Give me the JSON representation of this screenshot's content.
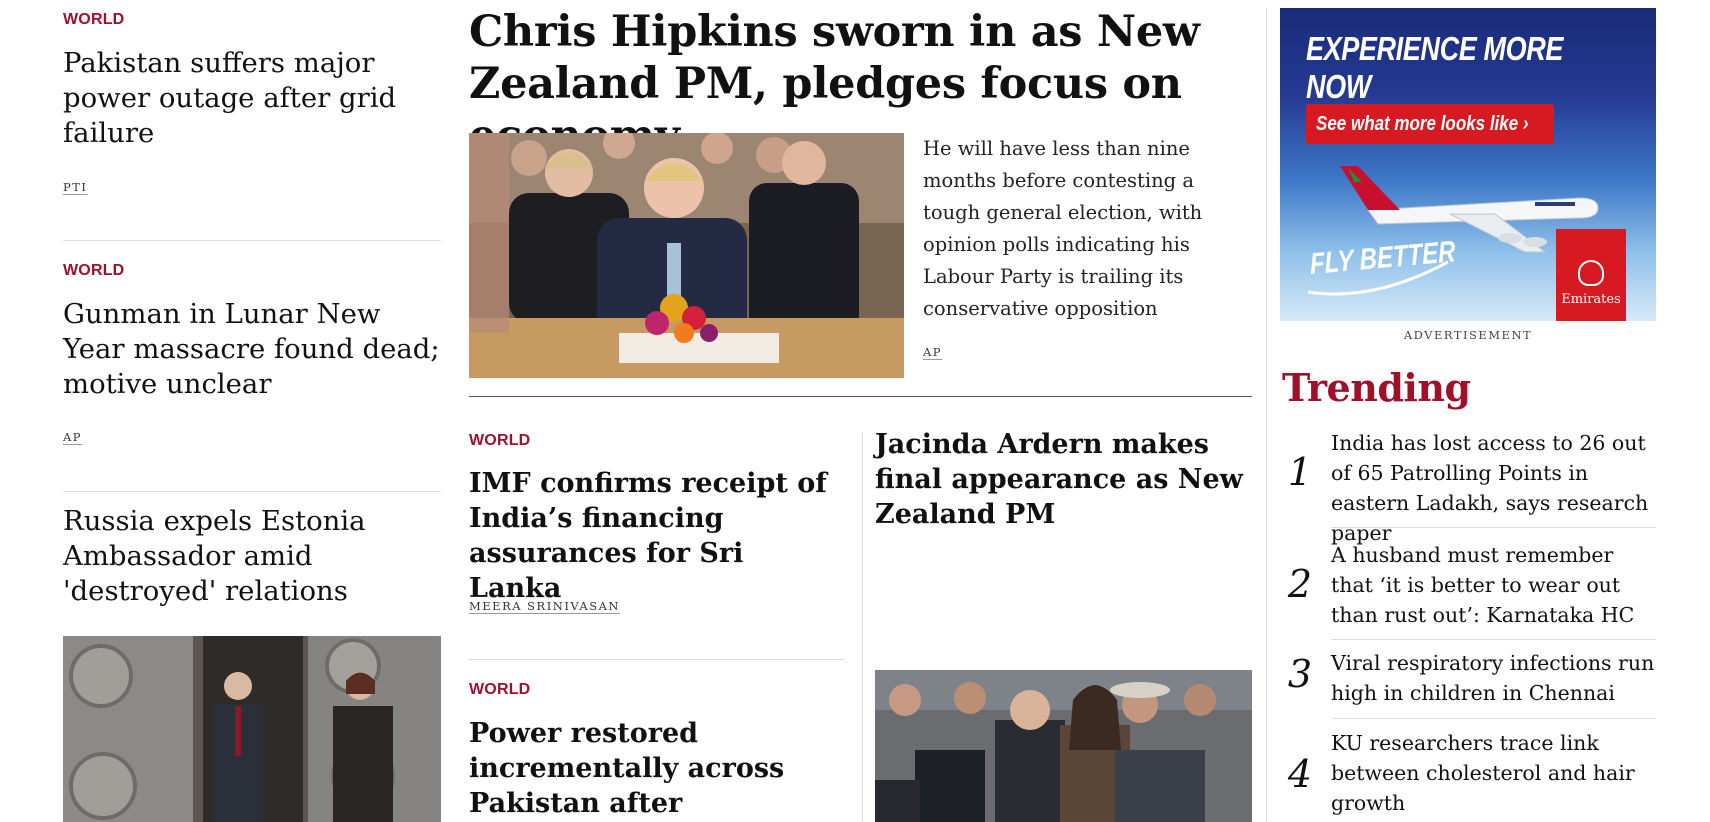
{
  "left_column": {
    "stories": [
      {
        "kicker": "WORLD",
        "headline": "Pakistan suffers major power outage after grid failure",
        "byline": "PTI"
      },
      {
        "kicker": "WORLD",
        "headline": "Gunman in Lunar New Year massacre found dead; motive unclear",
        "byline": "AP"
      },
      {
        "headline": "Russia expels Estonia Ambassador amid 'destroyed' relations"
      }
    ]
  },
  "lead_story": {
    "headline": "Chris Hipkins sworn in as New Zealand PM, pledges focus on economy",
    "summary": "He will have less than nine months before contesting a tough general election, with opinion polls indicating his Labour Party is trailing its conservative opposition",
    "byline": "AP"
  },
  "middle_stories": [
    {
      "kicker": "WORLD",
      "headline": "IMF confirms receipt of India’s financing assurances for Sri Lanka",
      "byline": "MEERA SRINIVASAN"
    },
    {
      "headline": "Jacinda Ardern makes final appearance as New Zealand PM"
    },
    {
      "kicker": "WORLD",
      "headline": "Power restored incrementally across Pakistan after nationwide"
    }
  ],
  "advertisement": {
    "tagline": "EXPERIENCE MORE NOW",
    "cta": "See what more looks like ›",
    "slogan": "FLY BETTER",
    "brand": "Emirates",
    "label": "ADVERTISEMENT"
  },
  "trending": {
    "title": "Trending",
    "items": [
      {
        "rank": "1",
        "text": "India has lost access to 26 out of 65 Patrolling Points in eastern Ladakh, says research paper"
      },
      {
        "rank": "2",
        "text": "A husband must remember that ‘it is better to wear out than rust out’: Karnataka HC"
      },
      {
        "rank": "3",
        "text": "Viral respiratory infections run high in children in Chennai"
      },
      {
        "rank": "4",
        "text": "KU researchers trace link between cholesterol and hair growth"
      }
    ]
  },
  "colors": {
    "accent": "#a0102a",
    "rule": "#dedede",
    "ad_red": "#d71a21"
  }
}
